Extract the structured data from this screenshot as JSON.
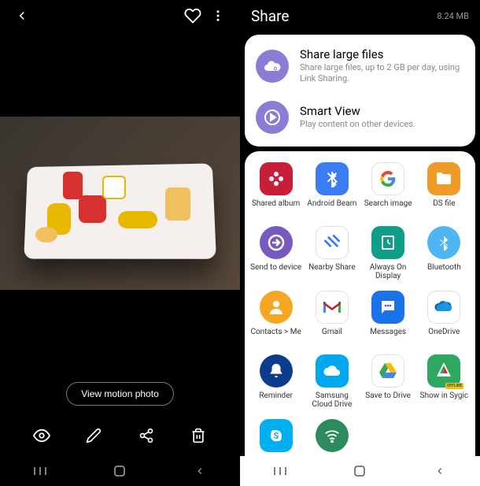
{
  "gallery": {
    "motion_button": "View motion photo"
  },
  "share": {
    "title": "Share",
    "file_size": "8.24 MB",
    "options": [
      {
        "title": "Share large files",
        "subtitle": "Share large files, up to 2 GB per day, using Link Sharing.",
        "icon": "cloud-link-icon",
        "color": "#8a7dd6"
      },
      {
        "title": "Smart View",
        "subtitle": "Play content on other devices.",
        "icon": "play-circle-icon",
        "color": "#8a7dd6"
      }
    ],
    "apps": [
      {
        "label": "Shared album",
        "icon": "flower-icon",
        "bg": "bg-red"
      },
      {
        "label": "Android Beam",
        "icon": "bluetooth-icon",
        "bg": "bg-blue"
      },
      {
        "label": "Search image",
        "icon": "google-g-icon",
        "bg": "bg-white"
      },
      {
        "label": "DS file",
        "icon": "folder-icon",
        "bg": "bg-orange"
      },
      {
        "label": "Send to device",
        "icon": "send-arrow-icon",
        "bg": "bg-purple"
      },
      {
        "label": "Nearby Share",
        "icon": "nearby-icon",
        "bg": "bg-white"
      },
      {
        "label": "Always On Display",
        "icon": "clock-icon",
        "bg": "bg-teal"
      },
      {
        "label": "Bluetooth",
        "icon": "bluetooth-icon",
        "bg": "bg-lblue"
      },
      {
        "label": "Contacts > Me",
        "icon": "person-icon",
        "bg": "bg-orange2"
      },
      {
        "label": "Gmail",
        "icon": "gmail-icon",
        "bg": "bg-white"
      },
      {
        "label": "Messages",
        "icon": "messages-icon",
        "bg": "bg-dblue"
      },
      {
        "label": "OneDrive",
        "icon": "cloud-icon",
        "bg": "bg-white"
      },
      {
        "label": "Reminder",
        "icon": "bell-icon",
        "bg": "bg-navy"
      },
      {
        "label": "Samsung Cloud Drive",
        "icon": "cloud-icon",
        "bg": "bg-sky"
      },
      {
        "label": "Save to Drive",
        "icon": "drive-icon",
        "bg": "bg-white"
      },
      {
        "label": "Show in Sygic",
        "icon": "sygic-icon",
        "bg": "bg-green",
        "badge": "OFFLINE"
      },
      {
        "label": "",
        "icon": "skype-icon",
        "bg": "bg-skype"
      },
      {
        "label": "",
        "icon": "wifi-icon",
        "bg": "bg-wifi"
      }
    ]
  }
}
